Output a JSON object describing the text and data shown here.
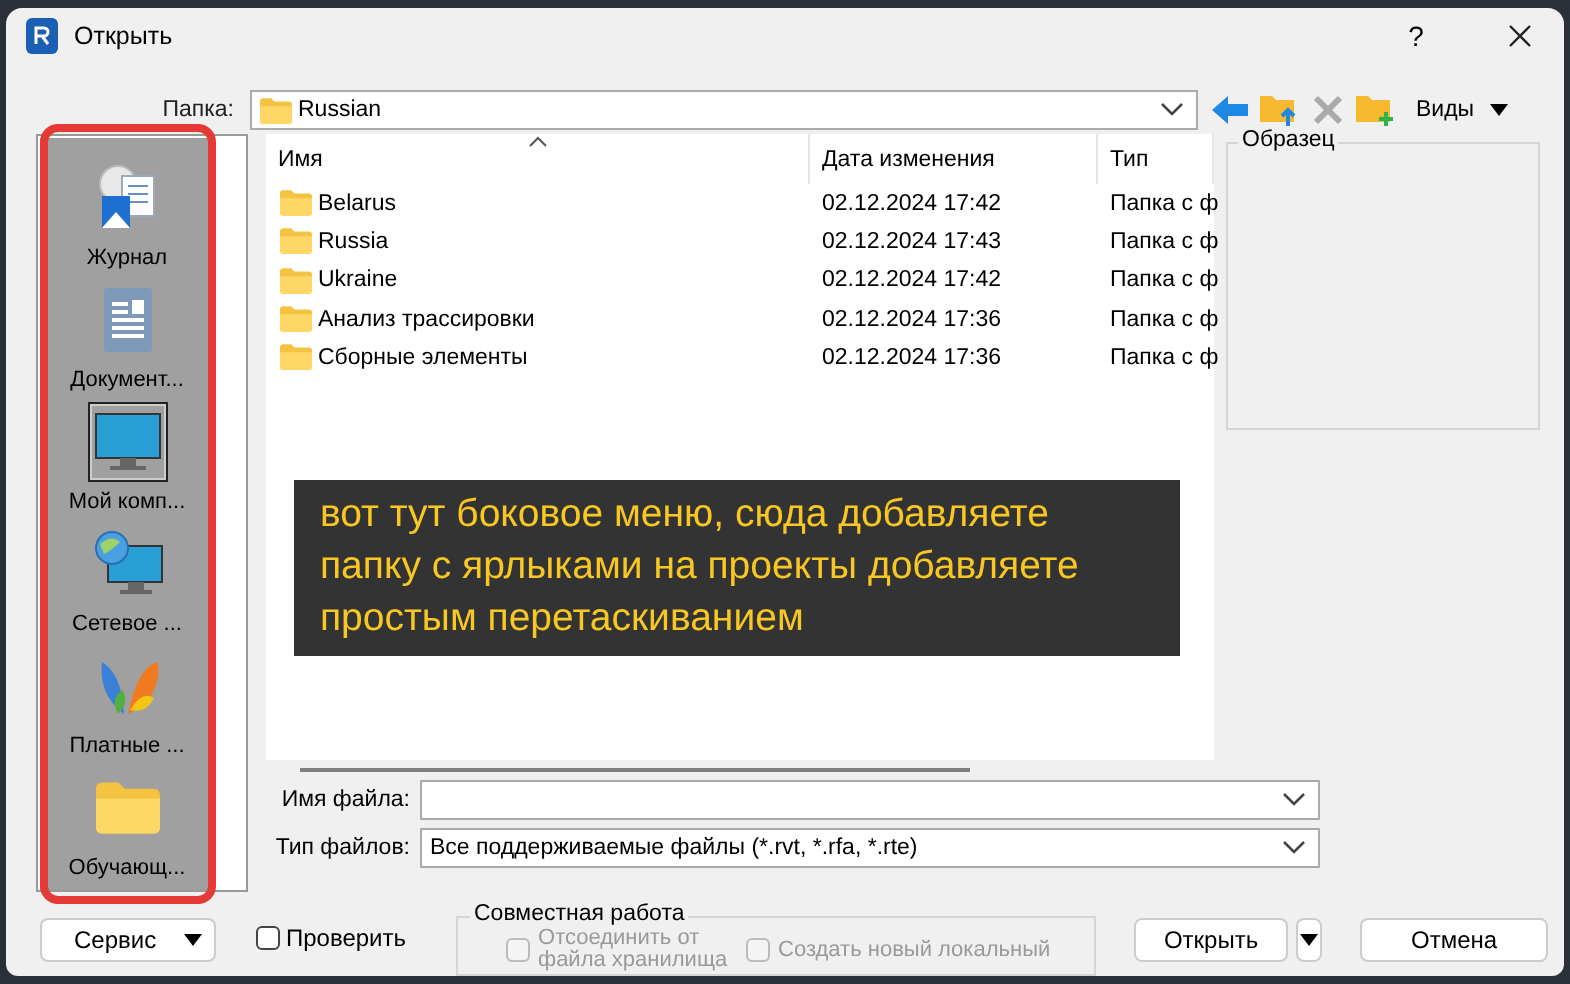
{
  "window": {
    "title": "Открыть",
    "help_button": "?"
  },
  "folder": {
    "label": "Папка:",
    "value": "Russian"
  },
  "toolbar": {
    "views_label": "Виды"
  },
  "sidebar": {
    "items": [
      {
        "kind": "journal",
        "label": "Журнал",
        "selected": false
      },
      {
        "kind": "documents",
        "label": "Документ...",
        "selected": false
      },
      {
        "kind": "computer",
        "label": "Мой комп...",
        "selected": true
      },
      {
        "kind": "network",
        "label": "Сетевое ...",
        "selected": false
      },
      {
        "kind": "favorites",
        "label": "Платные ...",
        "selected": false
      },
      {
        "kind": "folder",
        "label": "Обучающ...",
        "selected": false
      }
    ]
  },
  "table": {
    "columns": [
      {
        "label": "Имя",
        "sorted": true
      },
      {
        "label": "Дата изменения",
        "sorted": false
      },
      {
        "label": "Тип",
        "sorted": false
      }
    ],
    "rows": [
      {
        "name": "Belarus",
        "date": "02.12.2024 17:42",
        "type": "Папка с ф"
      },
      {
        "name": "Russia",
        "date": "02.12.2024 17:43",
        "type": "Папка с ф"
      },
      {
        "name": "Ukraine",
        "date": "02.12.2024 17:42",
        "type": "Папка с ф"
      },
      {
        "name": "Анализ трассировки",
        "date": "02.12.2024 17:36",
        "type": "Папка с ф"
      },
      {
        "name": "Сборные элементы",
        "date": "02.12.2024 17:36",
        "type": "Папка с ф"
      }
    ]
  },
  "preview": {
    "title": "Образец"
  },
  "file_name": {
    "label": "Имя файла:"
  },
  "file_type": {
    "label": "Тип файлов:",
    "value": "Все поддерживаемые файлы (*.rvt, *.rfa, *.rte)"
  },
  "tools_button": "Сервис",
  "audit": {
    "label": "Проверить",
    "checked": false
  },
  "worksharing": {
    "title": "Совместная работа",
    "options": [
      {
        "label": "Отсоединить от файла хранилища",
        "checked": false,
        "disabled": true
      },
      {
        "label": "Создать новый локальный",
        "checked": false,
        "disabled": true
      }
    ]
  },
  "open_button": "Открыть",
  "cancel_button": "Отмена",
  "annotation": {
    "text": "вот тут боковое меню, сюда добавляете папку с ярлыками на проекты добавляете простым перетаскиванием"
  }
}
